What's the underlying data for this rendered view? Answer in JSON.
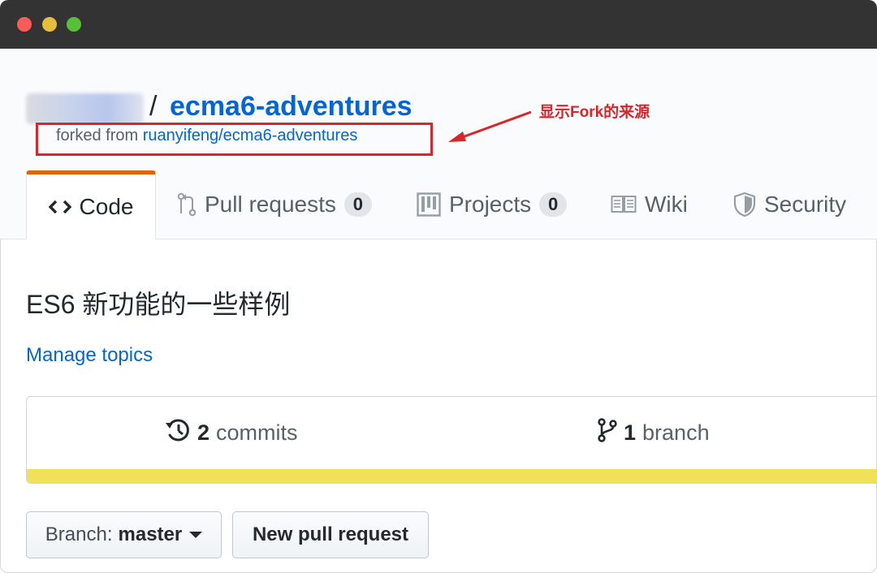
{
  "repo": {
    "separator": "/",
    "name": "ecma6-adventures",
    "forked_prefix": "forked from",
    "forked_source": "ruanyifeng/ecma6-adventures"
  },
  "annotation": {
    "text": "显示Fork的来源",
    "color": "#d9262b"
  },
  "tabs": [
    {
      "label": "Code",
      "icon": "code-icon",
      "selected": true
    },
    {
      "label": "Pull requests",
      "icon": "pull-request-icon",
      "count": "0"
    },
    {
      "label": "Projects",
      "icon": "project-icon",
      "count": "0"
    },
    {
      "label": "Wiki",
      "icon": "book-icon"
    },
    {
      "label": "Security",
      "icon": "shield-icon"
    }
  ],
  "description": "ES6 新功能的一些样例",
  "manage_topics": "Manage topics",
  "summary": {
    "commits_count": "2",
    "commits_label": "commits",
    "branch_count": "1",
    "branch_label": "branch",
    "language_color": "#f1e05a"
  },
  "buttons": {
    "branch_label": "Branch:",
    "branch_value": "master",
    "new_pull_request": "New pull request"
  },
  "colors": {
    "link": "#0366d6",
    "tab_accent": "#e36209",
    "titlebar": "#333333"
  }
}
